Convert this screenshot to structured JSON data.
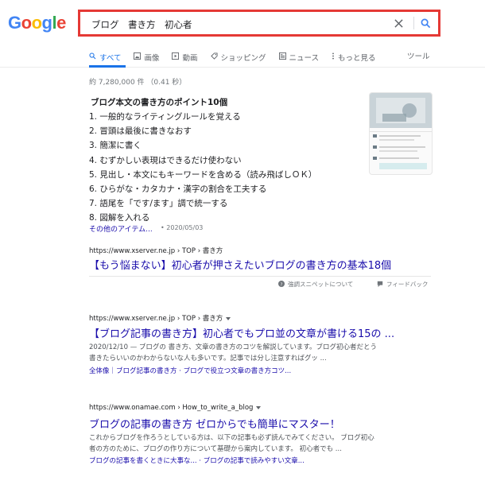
{
  "logo": {
    "letters": [
      "G",
      "o",
      "o",
      "g",
      "l",
      "e"
    ],
    "colors": [
      "#4285F4",
      "#EA4335",
      "#FBBC05",
      "#4285F4",
      "#34A853",
      "#EA4335"
    ]
  },
  "search": {
    "query": "ブログ　書き方　初心者",
    "clear_icon": "close-icon",
    "search_icon": "search-icon",
    "highlight_color": "#e53935"
  },
  "tabs": [
    {
      "label": "すべて",
      "icon": "search-icon",
      "active": true
    },
    {
      "label": "画像",
      "icon": "image-icon"
    },
    {
      "label": "動画",
      "icon": "video-icon"
    },
    {
      "label": "ショッピング",
      "icon": "tag-icon"
    },
    {
      "label": "ニュース",
      "icon": "news-icon"
    },
    {
      "label": "もっと見る",
      "icon": "more-icon"
    }
  ],
  "tools_label": "ツール",
  "stats": "約 7,280,000 件 （0.41 秒）",
  "featured": {
    "title": "ブログ本文の書き方のポイント10個",
    "items": [
      "1.  一般的なライティングルールを覚える",
      "2.  冒頭は最後に書きなおす",
      "3.  簡潔に書く",
      "4.  むずかしい表現はできるだけ使わない",
      "5.  見出し・本文にもキーワードを含める（読み飛ばしＯＫ）",
      "6.  ひらがな・カタカナ・漢字の割合を工夫する",
      "7.  語尾を「です/ます」調で統一する",
      "8.  図解を入れる"
    ],
    "more_label": "その他のアイテム...",
    "date": "• 2020/05/03",
    "url": "https://www.xserver.ne.jp › TOP › 書き方",
    "link_title": "【もう悩まない】初心者が押さえたいブログの書き方の基本18個",
    "about_label": "強調スニペットについて",
    "feedback_label": "フィードバック"
  },
  "results": [
    {
      "url": "https://www.xserver.ne.jp › TOP › 書き方",
      "title": "【ブログ記事の書き方】初心者でもプロ並の文章が書ける15の ...",
      "snippet1": "2020/12/10 — ブログの 書き方、文章の書き方のコツを解説しています。ブログ初心者だとう",
      "snippet2": "書きたらいいのかわからないな人も多いです。記事では分し注意すればグッ ...",
      "sitelinks": "全体像｜ブログ記事の書き方 · ブログで役立つ文章の書き方コツ..."
    },
    {
      "url": "https://www.onamae.com › How_to_write_a_blog",
      "title": "ブログの記事の書き方 ゼロからでも簡単にマスター！",
      "snippet1": "これからブログを作ろうとしている方は、以下の記事も必ず読んでみてください。 ブログ初心",
      "snippet2": "者の方のために、ブログの作り方について基礎から案内しています。 初心者でも ...",
      "sitelinks": "ブログの記事を書くときに大事な... · ブログの記事で読みやすい文章..."
    }
  ],
  "colors": {
    "link": "#1a0dab",
    "accent": "#1a73e8",
    "muted": "#70757a"
  }
}
